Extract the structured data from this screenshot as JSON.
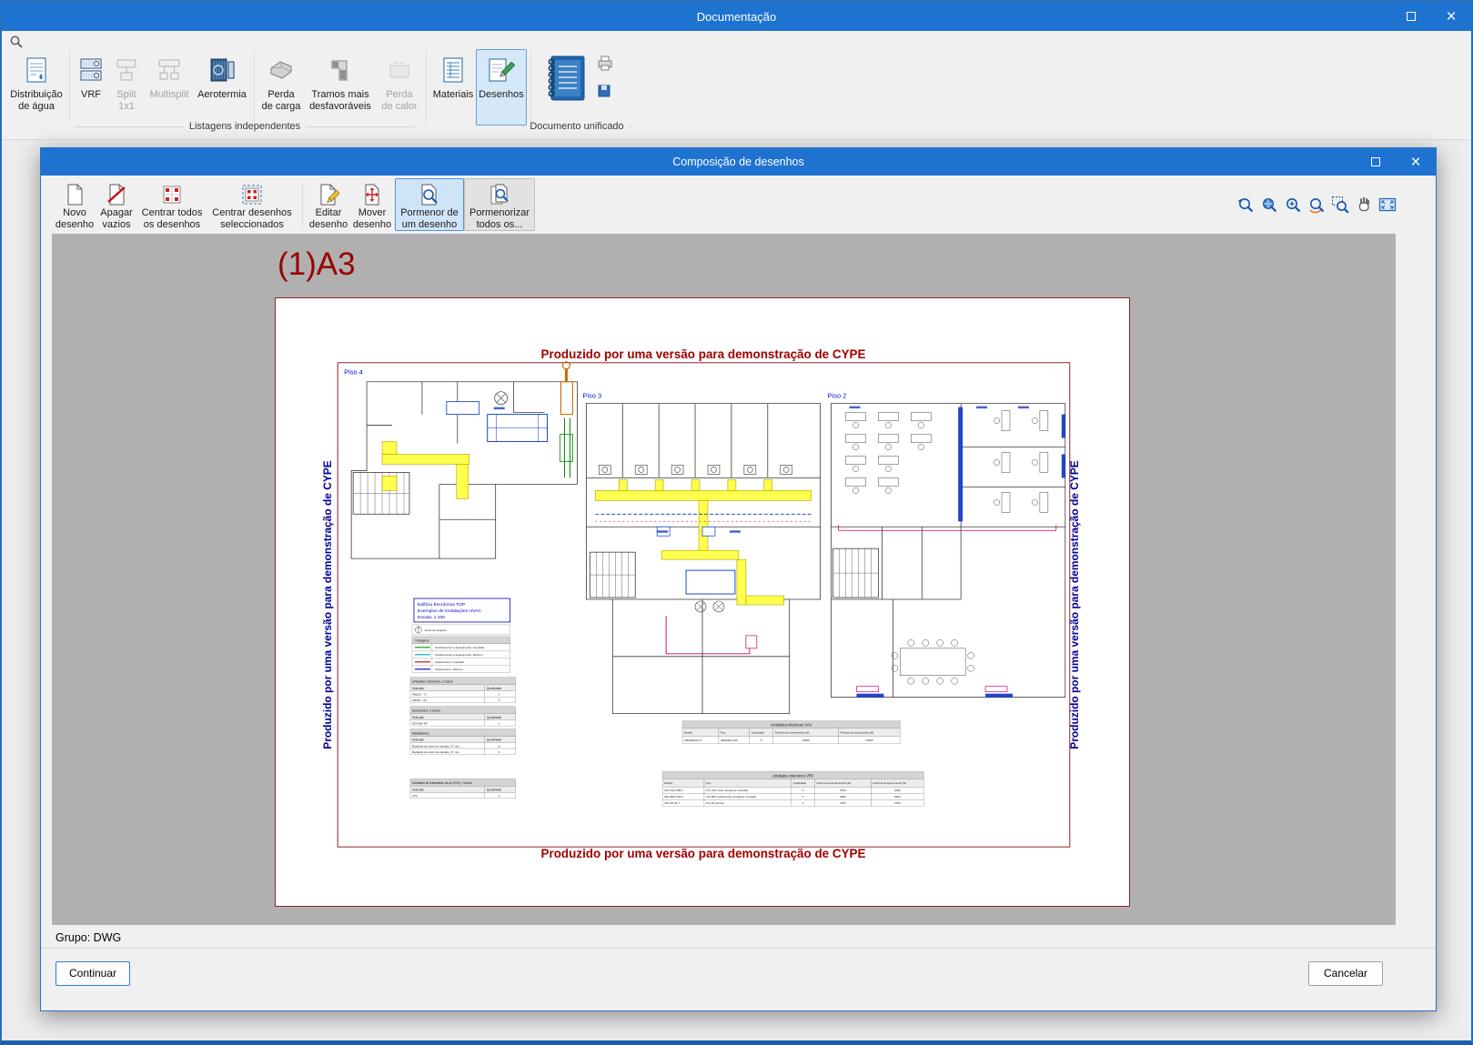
{
  "window": {
    "title": "Documentação"
  },
  "icons": {
    "maximize": "maximize-box",
    "close": "×",
    "search": "magnifier"
  },
  "colors": {
    "titlebar": "#1e73d0",
    "selection": "#cfe4f7",
    "canvas": "#b0b0b0",
    "sheet_border": "#8b2525",
    "demo_text": "#a00000",
    "vertical_text": "#000099"
  },
  "ribbon": {
    "buttons": [
      {
        "label": "Distribuição de água",
        "state": "normal"
      },
      {
        "label": "VRF",
        "state": "normal"
      },
      {
        "label": "Split 1x1",
        "state": "disabled"
      },
      {
        "label": "Multisplit",
        "state": "disabled"
      },
      {
        "label": "Aerotermia",
        "state": "normal"
      },
      {
        "label": "Perda de carga",
        "state": "normal"
      },
      {
        "label": "Tramos mais desfavoráveis",
        "state": "normal"
      },
      {
        "label": "Perda de calor",
        "state": "disabled"
      },
      {
        "label": "Materiais",
        "state": "normal"
      },
      {
        "label": "Desenhos",
        "state": "selected"
      }
    ],
    "group_labels": [
      "Listagens independentes",
      "Documento unificado"
    ]
  },
  "dialog": {
    "title": "Composição de desenhos",
    "toolbar": [
      {
        "label": "Novo desenho",
        "state": "normal"
      },
      {
        "label": "Apagar vazios",
        "state": "normal"
      },
      {
        "label": "Centrar todos os desenhos",
        "state": "normal"
      },
      {
        "label": "Centrar desenhos seleccionados",
        "state": "normal"
      },
      {
        "label": "Editar desenho",
        "state": "normal"
      },
      {
        "label": "Mover desenho",
        "state": "normal"
      },
      {
        "label": "Pormenor de um desenho",
        "state": "selected"
      },
      {
        "label": "Pormenorizar todos os...",
        "state": "highlight"
      }
    ],
    "zoom_tools": [
      "zoom-previous",
      "zoom-extents",
      "zoom-scale",
      "zoom-redraw",
      "zoom-window",
      "pan-hand",
      "fit-screen"
    ],
    "status": "Grupo: DWG",
    "buttons": {
      "continue": "Continuar",
      "cancel": "Cancelar"
    }
  },
  "drawing": {
    "sheet_label": "(1)A3",
    "demo_text": "Produzido por uma versão para demonstração de CYPE",
    "floors": [
      {
        "label": "Piso 4"
      },
      {
        "label": "Piso 3"
      },
      {
        "label": "Piso 2"
      }
    ],
    "title_block": {
      "line1": "Edifício Escritórios TOP",
      "line2": "Exemplos de Instalações HVAC",
      "line3": "Escala: 1:100"
    },
    "legend": {
      "north": "Norte do projecto",
      "pipes_title": "Tubagens",
      "pipe_rows": [
        {
          "color": "#009900",
          "label": "Arrefecimento e aquecimento, Impulsão"
        },
        {
          "color": "#00aaaa",
          "label": "Arrefecimento e aquecimento, Retorno"
        },
        {
          "color": "#cc0000",
          "label": "Aquecimento, Impulsão"
        },
        {
          "color": "#0000cc",
          "label": "Aquecimento, Retorno"
        }
      ],
      "col_sel": "Selecção",
      "col_qty": "Quantidade",
      "mini_tables": [
        {
          "title": "Unidades interiores, 2 tubos",
          "rows": [
            [
              "FBQ50 - 71",
              "2"
            ],
            [
              "FBA60 - 24",
              "1"
            ]
          ]
        },
        {
          "title": "Acessórios, 2 tubos",
          "rows": [
            [
              "EZ4-082-NF",
              "1"
            ]
          ]
        },
        {
          "title": "Radiadores",
          "rows": [
            [
              "Radiador de alumínio injetado, 57 mm",
              "8"
            ],
            [
              "Radiador de alumínio injetado, 67 mm",
              "3"
            ]
          ]
        },
        {
          "title": "Unidades de tratamento de ar (UTA), 2 tubos",
          "rows": [
            [
              "UTA",
              "1"
            ]
          ]
        }
      ]
    },
    "tables": {
      "vav": {
        "title": "Unidades interiores VAV",
        "headers": [
          "Modelo",
          "Tipo",
          "Quantidade",
          "Potência de arrefecimento (W)",
          "Potência de aquecimento (W)"
        ],
        "rows": [
          [
            "ABQDEA12-5",
            "ABQDEA-100",
            "5",
            "12000",
            "14000"
          ]
        ]
      },
      "vrf": {
        "title": "Unidades interiores VRF",
        "headers": [
          "Modelo",
          "Tipo",
          "Quantidade",
          "Potência de arrefecimento (W)",
          "Potência de aquecimento (W)"
        ],
        "rows": [
          [
            "AP2-4CC-BB-7",
            "A*2-4CC (teto compacto conduta)",
            "3",
            "3372",
            "4000"
          ],
          [
            "AP2-BC2-SN-F",
            "A*2-BC2 (pavimento compacto conduta)",
            "1",
            "5600",
            "6300"
          ],
          [
            "AP2-W-33-7",
            "A*2-W (mural)",
            "1",
            "3372",
            "3700"
          ]
        ]
      }
    }
  }
}
